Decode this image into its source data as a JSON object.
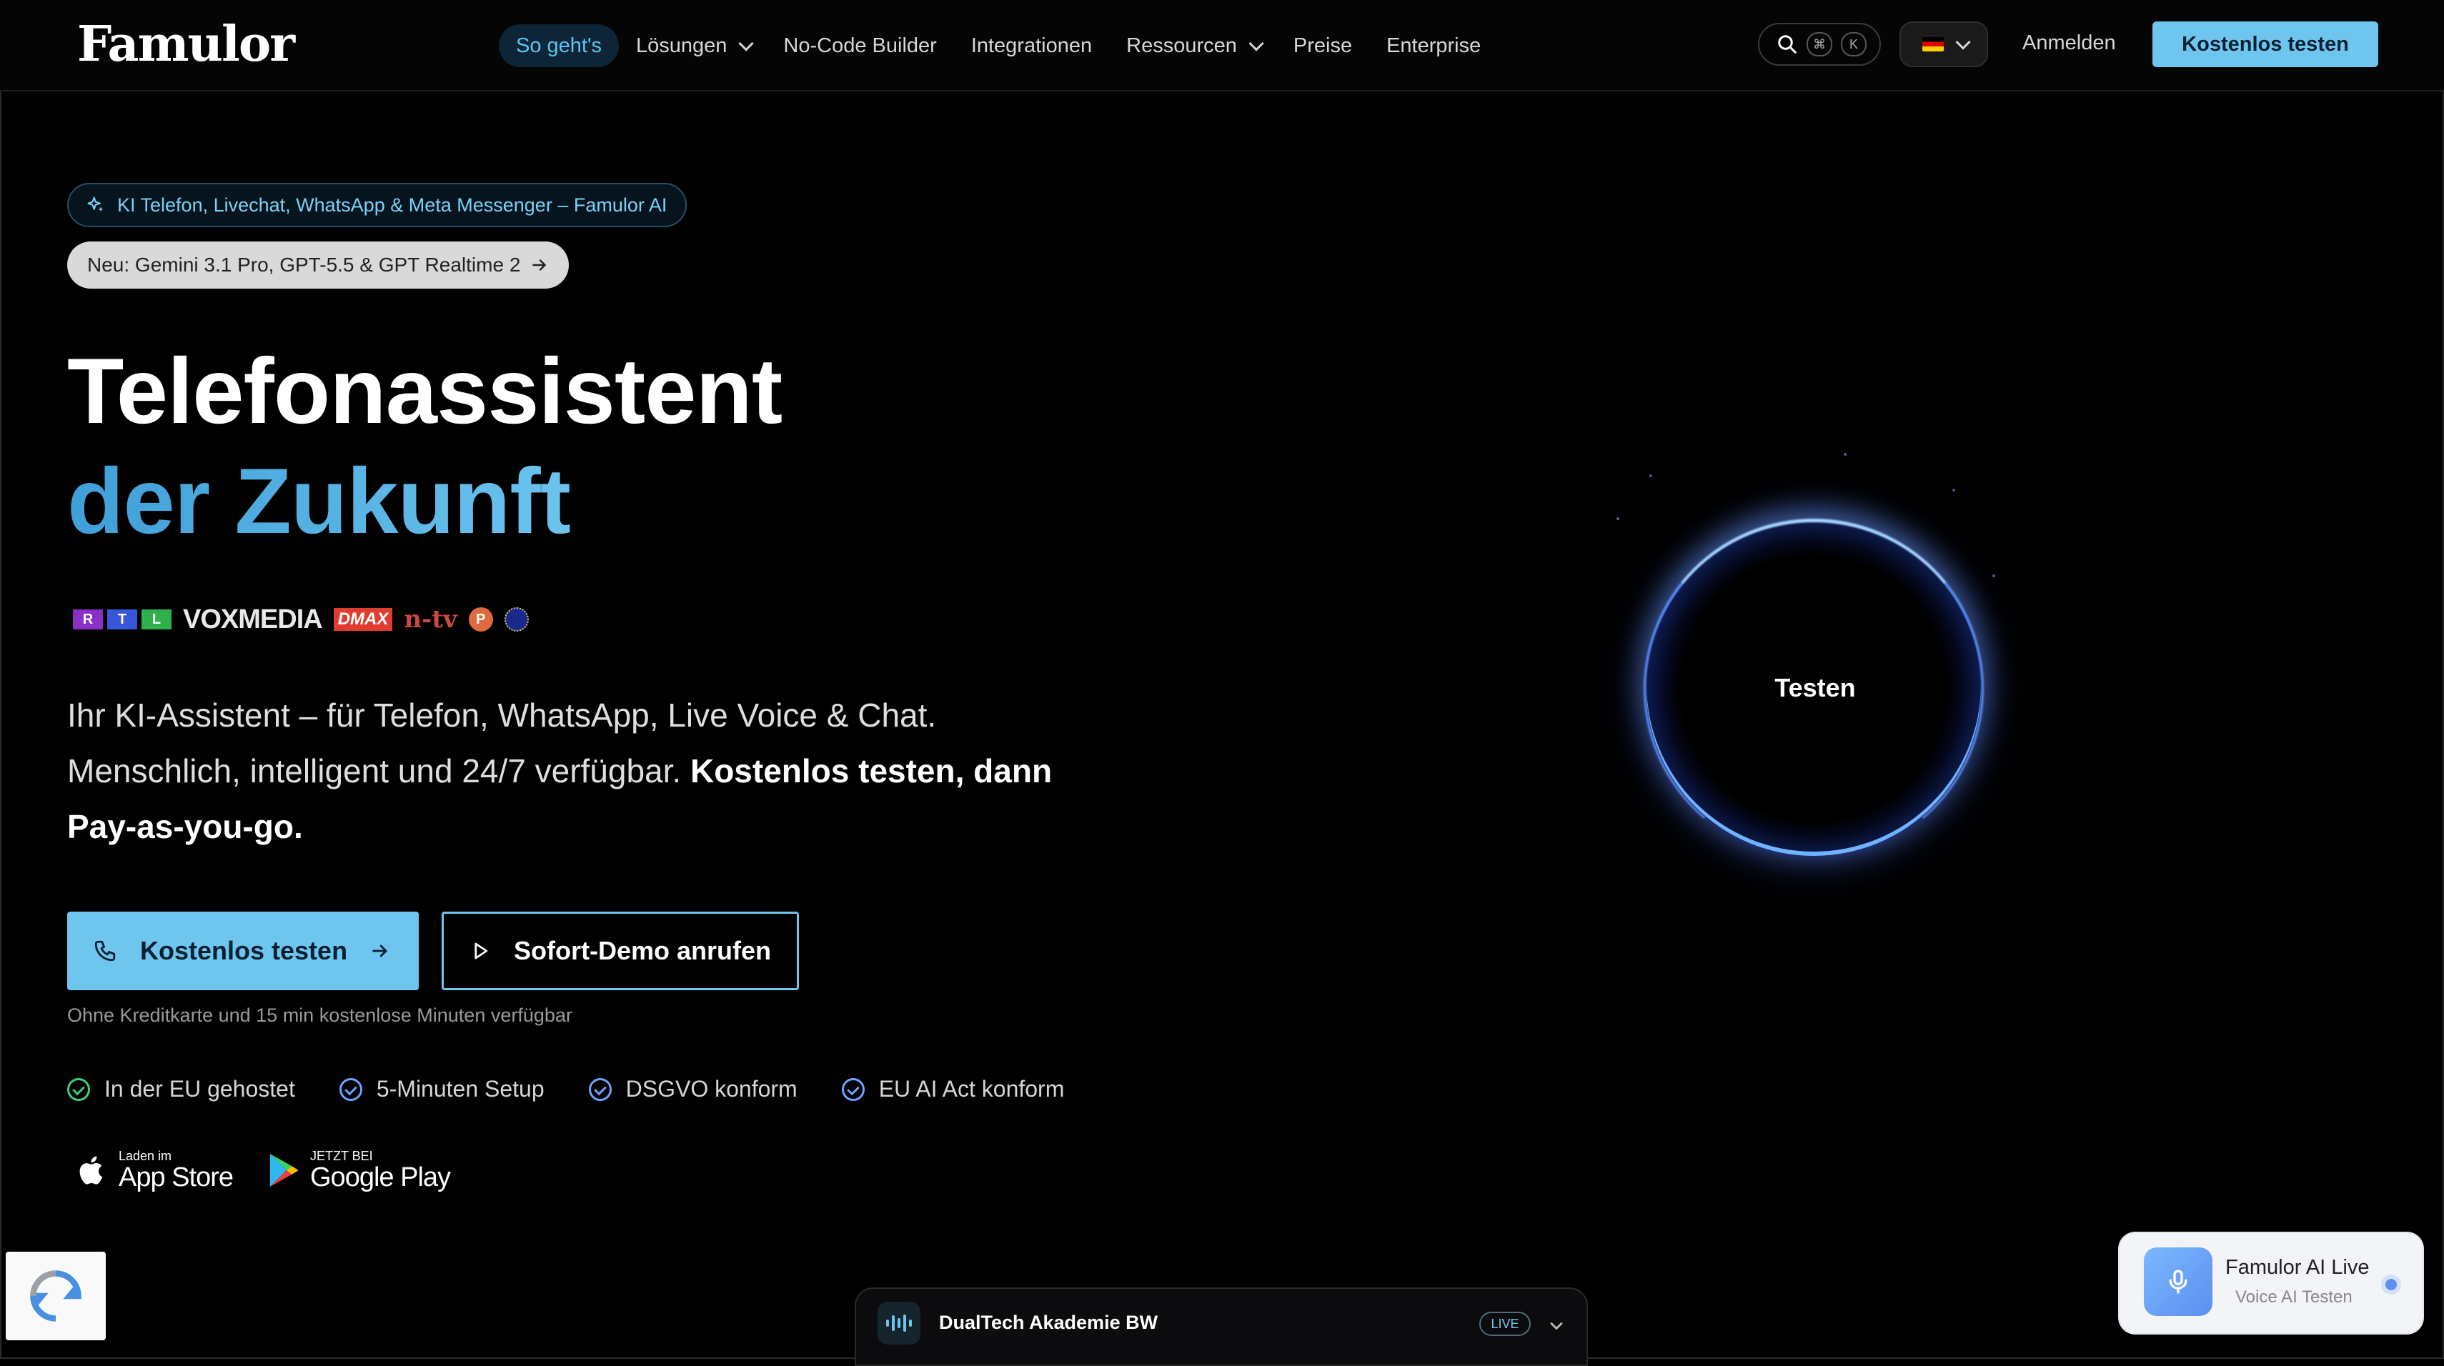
{
  "nav": {
    "logo": "Famulor",
    "items": [
      {
        "label": "So geht's",
        "active": true,
        "dropdown": false
      },
      {
        "label": "Lösungen",
        "active": false,
        "dropdown": true
      },
      {
        "label": "No-Code Builder",
        "active": false,
        "dropdown": false
      },
      {
        "label": "Integrationen",
        "active": false,
        "dropdown": false
      },
      {
        "label": "Ressourcen",
        "active": false,
        "dropdown": true
      },
      {
        "label": "Preise",
        "active": false,
        "dropdown": false
      },
      {
        "label": "Enterprise",
        "active": false,
        "dropdown": false
      }
    ],
    "search_shortcut": [
      "⌘",
      "K"
    ],
    "login": "Anmelden",
    "cta": "Kostenlos testen"
  },
  "hero": {
    "badge_primary": "KI Telefon, Livechat, WhatsApp & Meta Messenger – Famulor AI",
    "badge_secondary": "Neu: Gemini 3.1 Pro, GPT-5.5 & GPT Realtime 2",
    "title_line1": "Telefonassistent",
    "title_line2": "der Zukunft",
    "logos": {
      "rtl": [
        "R",
        "T",
        "L"
      ],
      "vox": "VOXMEDIA",
      "dmax": "DMAX",
      "ntv": "n-tv",
      "pro": "P"
    },
    "description_plain": "Ihr KI-Assistent – für Telefon, WhatsApp, Live Voice & Chat. Menschlich, intelligent und 24/7 verfügbar.",
    "description_bold": "Kostenlos testen, dann Pay-as-you-go.",
    "btn_primary": "Kostenlos testen",
    "btn_secondary": "Sofort-Demo anrufen",
    "note": "Ohne Kreditkarte und 15 min kostenlose Minuten verfügbar",
    "checks": [
      "In der EU gehostet",
      "5-Minuten Setup",
      "DSGVO konform",
      "EU AI Act konform"
    ],
    "stores": [
      {
        "small": "Laden im",
        "big": "App Store",
        "icon": "apple-icon"
      },
      {
        "small": "JETZT BEI",
        "big": "Google Play",
        "icon": "google-play-icon"
      }
    ],
    "orb_label": "Testen"
  },
  "live_bar": {
    "title": "DualTech Akademie BW",
    "badge": "LIVE"
  },
  "voice_widget": {
    "title": "Famulor AI Live",
    "subtitle": "Voice AI Testen"
  },
  "colors": {
    "accent": "#6ec6ef",
    "accent_dark": "#062031",
    "check_green": "#3ccf7e",
    "check_blue": "#6ea2ff",
    "background": "#000000"
  }
}
